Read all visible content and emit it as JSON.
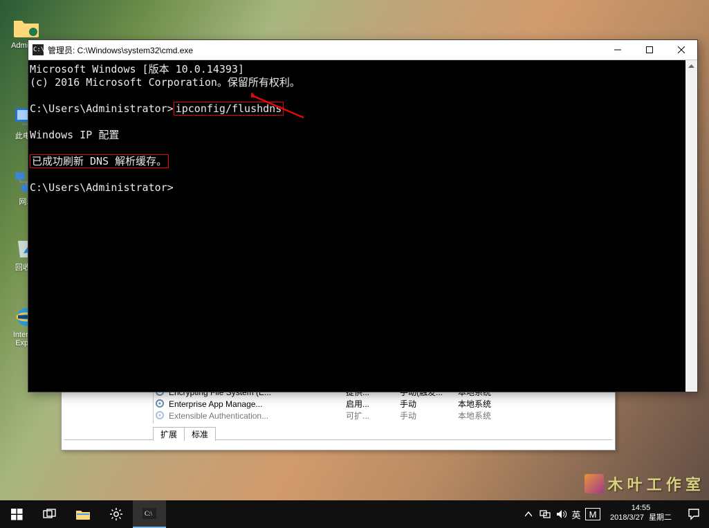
{
  "desktop_icons": {
    "admin": "Admini...",
    "this_pc": "此电...",
    "network": "网...",
    "recycle": "回收...",
    "ie": "Internet",
    "ie2": "Expl..."
  },
  "cmd": {
    "title": "管理员: C:\\Windows\\system32\\cmd.exe",
    "line1": "Microsoft Windows [版本 10.0.14393]",
    "line2": "(c) 2016 Microsoft Corporation。保留所有权利。",
    "prompt1": "C:\\Users\\Administrator>",
    "command1": "ipconfig/flushdns",
    "ipconfig_header": "Windows IP 配置",
    "success": "已成功刷新 DNS 解析缓存。",
    "prompt2": "C:\\Users\\Administrator>"
  },
  "services": {
    "row1": {
      "name": "Encrypting File System (E...",
      "desc": "提供...",
      "mode": "手动(触发...",
      "logon": "本地系统"
    },
    "row2": {
      "name": "Enterprise App Manage...",
      "desc": "启用...",
      "mode": "手动",
      "logon": "本地系统"
    },
    "row3": {
      "name": "Extensible Authentication...",
      "desc": "可扩...",
      "mode": "手动",
      "logon": "本地系统"
    },
    "tab_ext": "扩展",
    "tab_std": "标准"
  },
  "watermark": {
    "text": "木 叶 工 作 室"
  },
  "taskbar": {
    "ime_lang": "英",
    "ime_mode": "M",
    "time": "14:55",
    "date": "2018/3/27",
    "weekday": "星期二"
  }
}
